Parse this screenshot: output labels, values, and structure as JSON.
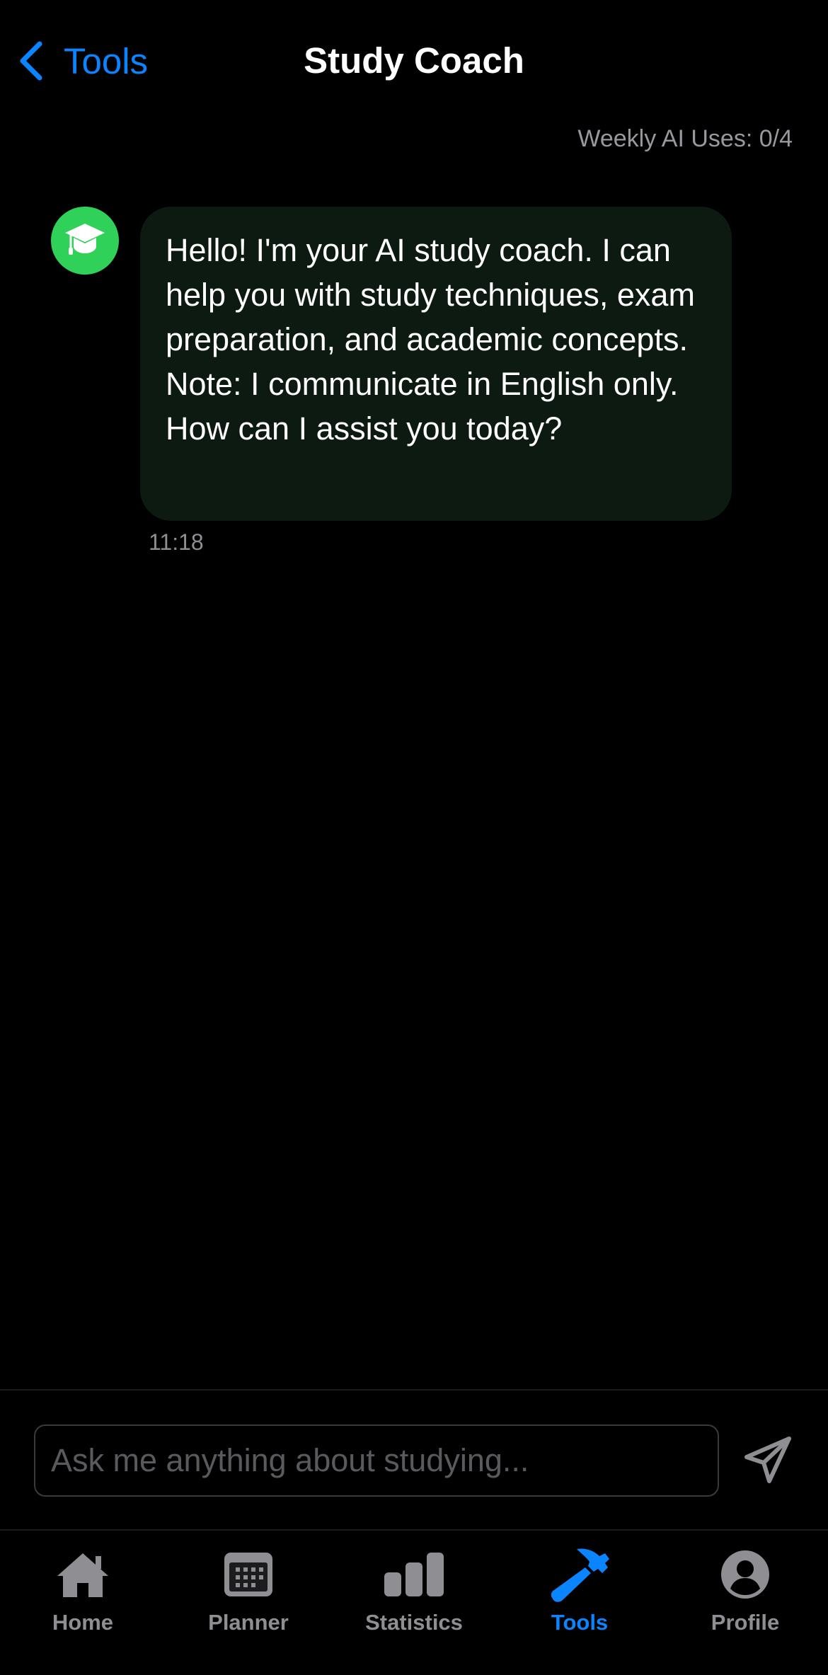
{
  "nav": {
    "back_label": "Tools",
    "title": "Study Coach"
  },
  "usage": {
    "text": "Weekly AI Uses: 0/4"
  },
  "messages": [
    {
      "sender": "coach",
      "avatar_icon": "graduation-cap-icon",
      "text": "Hello! I'm your AI study coach. I can help you with study techniques, exam preparation, and academic concepts. Note: I communicate in English only. How can I assist you today?",
      "time": "11:18"
    }
  ],
  "input": {
    "placeholder": "Ask me anything about studying...",
    "value": "",
    "send_icon": "paper-plane-icon"
  },
  "tabs": [
    {
      "label": "Home",
      "icon": "house-icon",
      "active": false
    },
    {
      "label": "Planner",
      "icon": "calendar-icon",
      "active": false
    },
    {
      "label": "Statistics",
      "icon": "bar-chart-icon",
      "active": false
    },
    {
      "label": "Tools",
      "icon": "hammer-icon",
      "active": true
    },
    {
      "label": "Profile",
      "icon": "person-circle-icon",
      "active": false
    }
  ],
  "colors": {
    "accent": "#0A84FF",
    "coach_avatar": "#30D158",
    "bubble_background": "#0D1A12",
    "inactive": "#8E8E93",
    "background": "#000000"
  }
}
